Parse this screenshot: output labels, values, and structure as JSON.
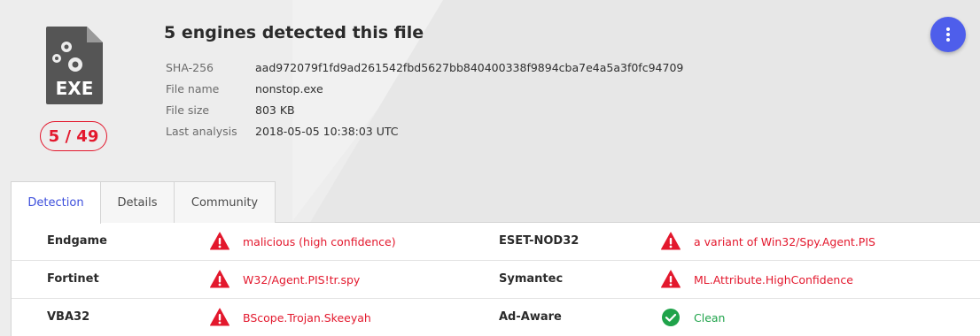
{
  "file": {
    "icon_label": "EXE",
    "title": "5 engines detected this file",
    "score": "5 / 49",
    "meta": [
      {
        "key": "SHA-256",
        "value": "aad972079f1fd9ad261542fbd5627bb840400338f9894cba7e4a5a3f0fc94709"
      },
      {
        "key": "File name",
        "value": "nonstop.exe"
      },
      {
        "key": "File size",
        "value": "803 KB"
      },
      {
        "key": "Last analysis",
        "value": "2018-05-05 10:38:03 UTC"
      }
    ]
  },
  "tabs": [
    {
      "label": "Detection",
      "active": true
    },
    {
      "label": "Details",
      "active": false
    },
    {
      "label": "Community",
      "active": false
    }
  ],
  "detections": [
    [
      {
        "engine": "Endgame",
        "result": "malicious (high confidence)",
        "status": "malicious",
        "icon": "warning-icon"
      },
      {
        "engine": "ESET-NOD32",
        "result": "a variant of Win32/Spy.Agent.PIS",
        "status": "malicious",
        "icon": "warning-icon"
      }
    ],
    [
      {
        "engine": "Fortinet",
        "result": "W32/Agent.PIS!tr.spy",
        "status": "malicious",
        "icon": "warning-icon"
      },
      {
        "engine": "Symantec",
        "result": "ML.Attribute.HighConfidence",
        "status": "malicious",
        "icon": "warning-icon"
      }
    ],
    [
      {
        "engine": "VBA32",
        "result": "BScope.Trojan.Skeeyah",
        "status": "malicious",
        "icon": "warning-icon"
      },
      {
        "engine": "Ad-Aware",
        "result": "Clean",
        "status": "clean",
        "icon": "check-circle-icon"
      }
    ]
  ],
  "colors": {
    "malicious": "#e3182d",
    "clean": "#1fa34a",
    "accent": "#4e5eeb",
    "active_tab": "#3d4fdc"
  },
  "more_button_icon": "more-vertical-icon"
}
